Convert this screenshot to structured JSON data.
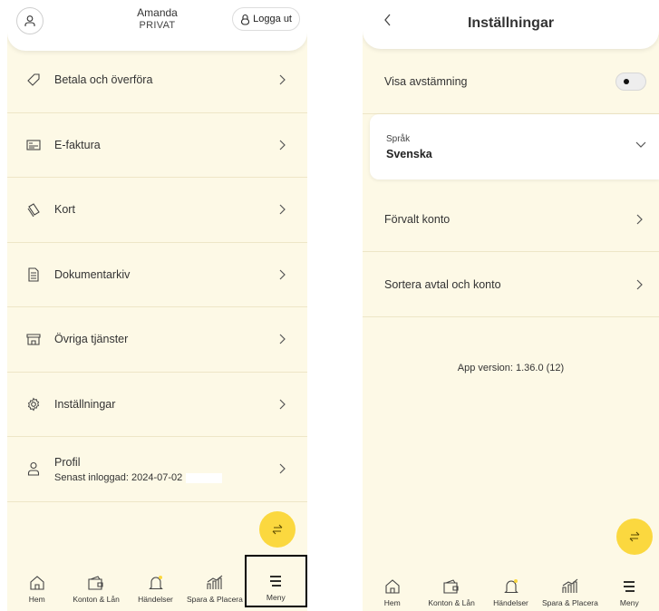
{
  "left": {
    "header": {
      "user_name": "Amanda",
      "user_type": "PRIVAT",
      "logout_label": "Logga ut"
    },
    "menu": [
      {
        "label": "Betala och överföra",
        "icon": "tag-icon"
      },
      {
        "label": "E-faktura",
        "icon": "invoice-icon"
      },
      {
        "label": "Kort",
        "icon": "card-icon"
      },
      {
        "label": "Dokumentarkiv",
        "icon": "document-icon"
      },
      {
        "label": "Övriga tjänster",
        "icon": "store-icon"
      },
      {
        "label": "Inställningar",
        "icon": "gear-icon"
      },
      {
        "label": "Profil",
        "sublabel": "Senast inloggad: 2024-07-02",
        "icon": "person-icon"
      }
    ]
  },
  "nav": {
    "items": [
      "Hem",
      "Konton & Lån",
      "Händelser",
      "Spara & Placera",
      "Meny"
    ]
  },
  "right": {
    "title": "Inställningar",
    "show_reconciliation": "Visa avstämning",
    "language_label": "Språk",
    "language_value": "Svenska",
    "default_account": "Förvalt konto",
    "sort_agreements": "Sortera avtal och konto",
    "app_version": "App version: 1.36.0 (12)"
  },
  "colors": {
    "accent": "#fbd83f",
    "background": "#fdf9e6"
  }
}
